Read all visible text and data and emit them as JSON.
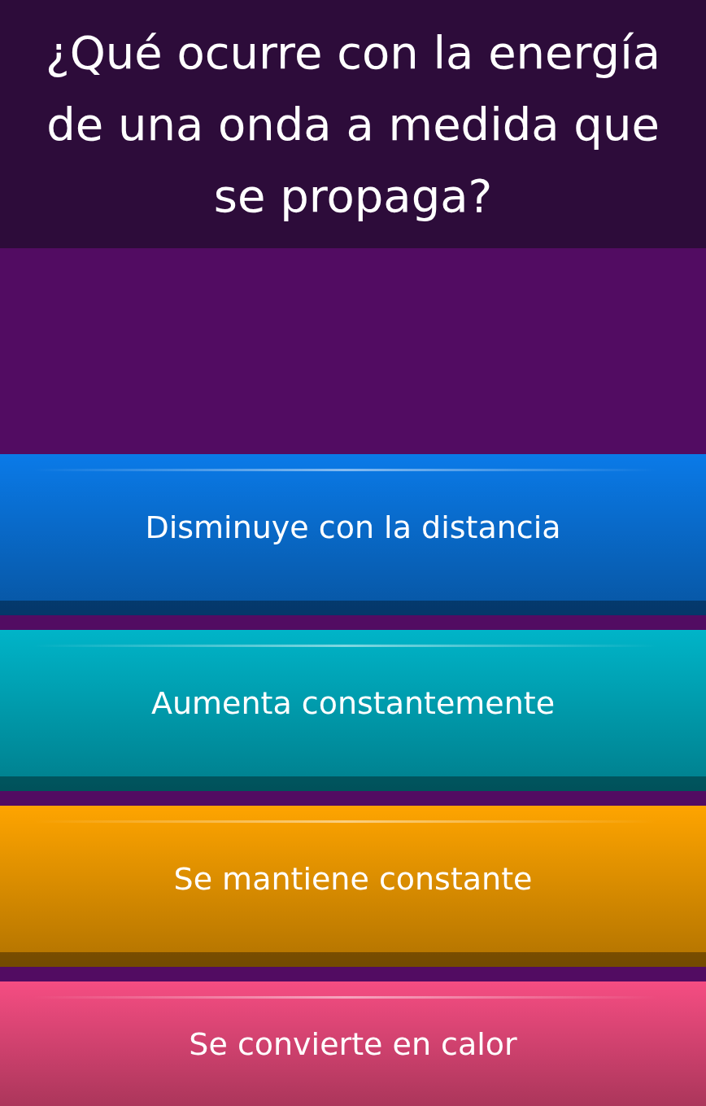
{
  "question": "¿Qué ocurre con la energía de una onda a medida que se propaga?",
  "answers": [
    {
      "label": "Disminuye con la distancia",
      "color": "#0a7ae8"
    },
    {
      "label": "Aumenta constantemente",
      "color": "#00b4c8"
    },
    {
      "label": "Se mantiene constante",
      "color": "#fea400"
    },
    {
      "label": "Se convierte en calor",
      "color": "#f54d82"
    }
  ]
}
